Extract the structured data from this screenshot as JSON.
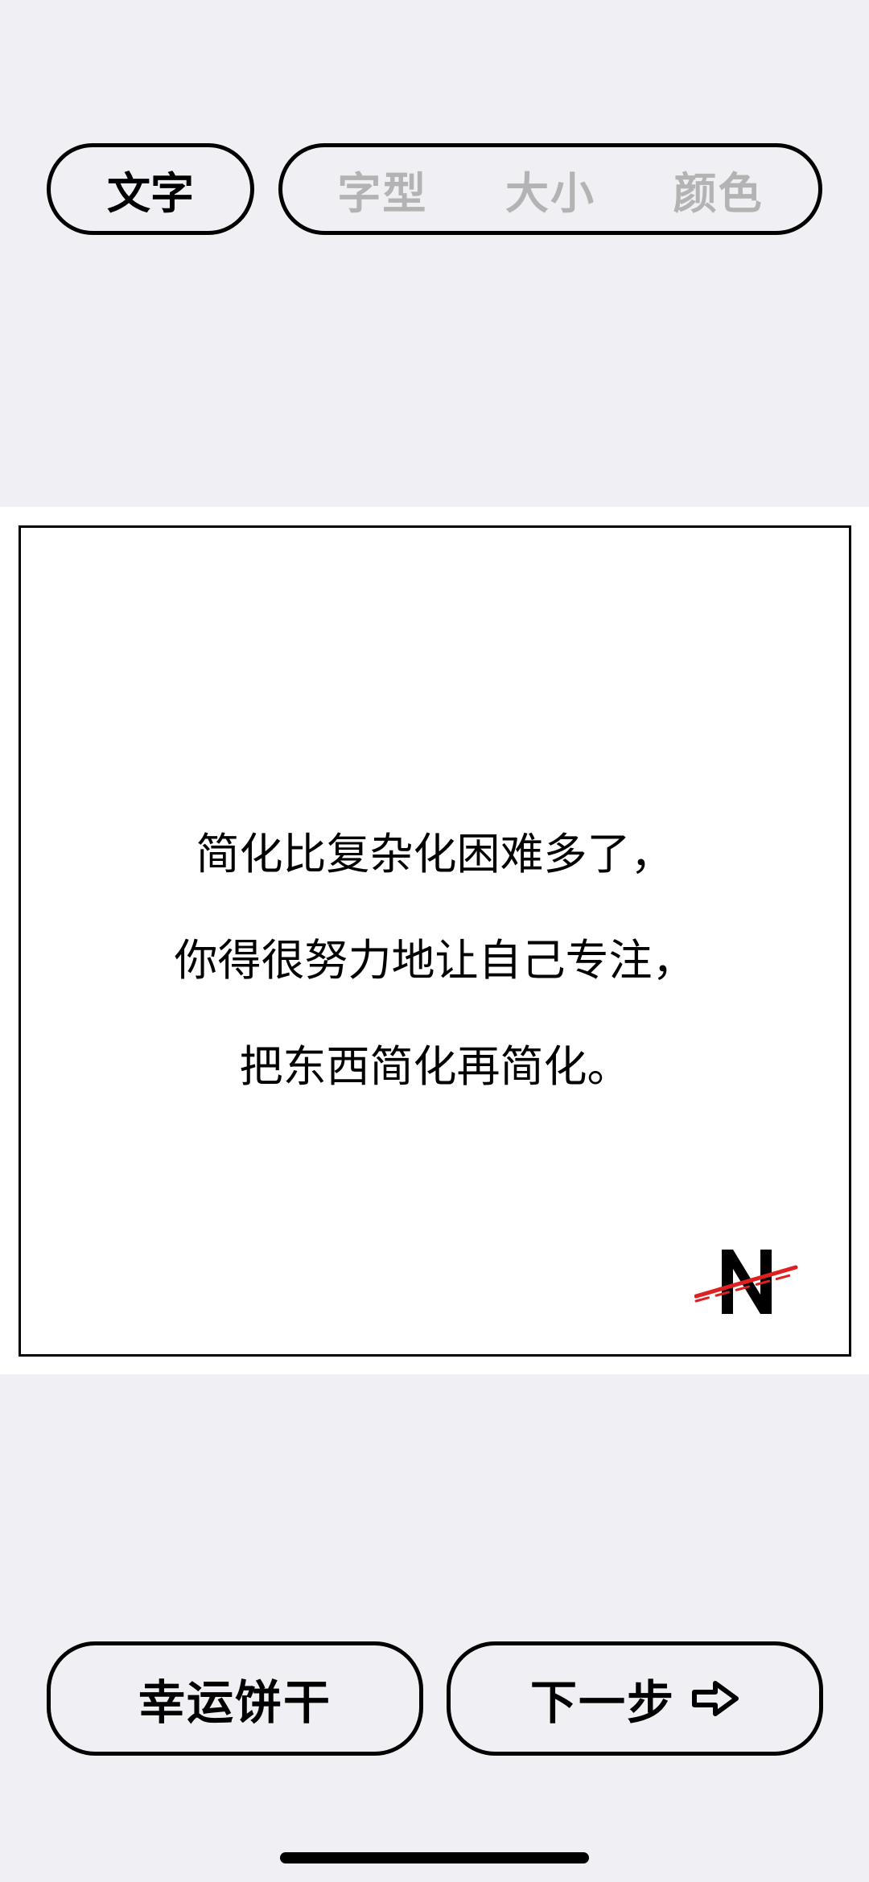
{
  "toolbar": {
    "text_tab": "文字",
    "font_tab": "字型",
    "size_tab": "大小",
    "color_tab": "颜色"
  },
  "canvas": {
    "quote_lines": [
      "简化比复杂化困难多了，",
      "你得很努力地让自己专注，",
      "把东西简化再简化。"
    ],
    "logo_letter": "N"
  },
  "actions": {
    "fortune_cookie_label": "幸运饼干",
    "next_step_label": "下一步"
  },
  "colors": {
    "background": "#f0f0f4",
    "inactive_text": "#b3b3b3",
    "logo_accent": "#e02020"
  },
  "icons": {
    "next_arrow": "arrow-right-outline-icon",
    "logo": "n-logo-icon"
  }
}
